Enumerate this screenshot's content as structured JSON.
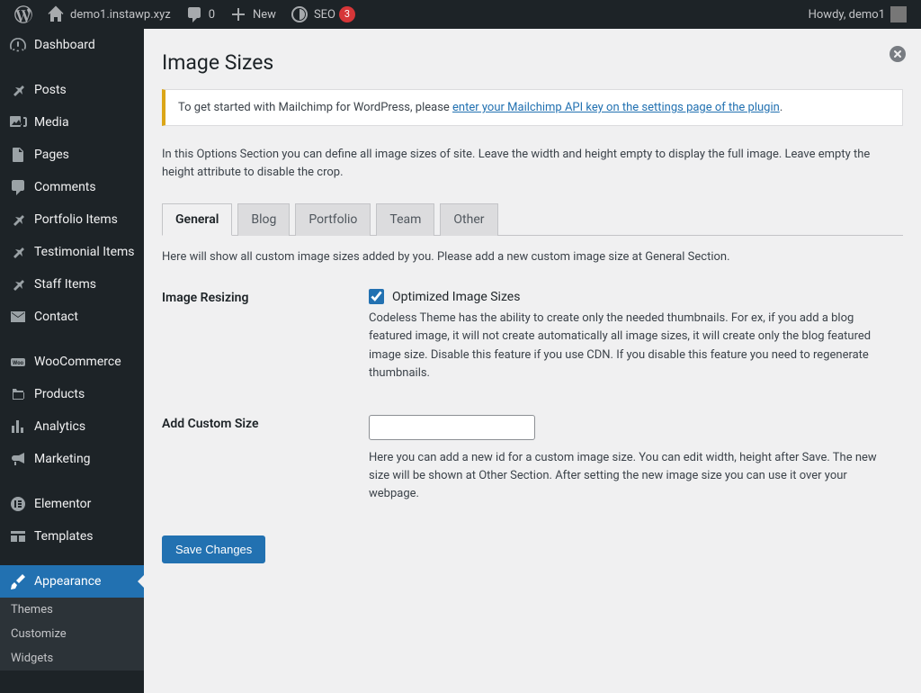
{
  "adminbar": {
    "site_name": "demo1.instawp.xyz",
    "comments_count": "0",
    "new_label": "New",
    "seo_label": "SEO",
    "seo_count": "3",
    "greeting": "Howdy, demo1"
  },
  "sidebar": {
    "items": [
      {
        "label": "Dashboard",
        "icon": "dashboard"
      },
      {
        "label": "Posts",
        "icon": "pin"
      },
      {
        "label": "Media",
        "icon": "media"
      },
      {
        "label": "Pages",
        "icon": "page"
      },
      {
        "label": "Comments",
        "icon": "comments"
      },
      {
        "label": "Portfolio Items",
        "icon": "pin"
      },
      {
        "label": "Testimonial Items",
        "icon": "pin"
      },
      {
        "label": "Staff Items",
        "icon": "pin"
      },
      {
        "label": "Contact",
        "icon": "mail"
      },
      {
        "label": "WooCommerce",
        "icon": "woo"
      },
      {
        "label": "Products",
        "icon": "product"
      },
      {
        "label": "Analytics",
        "icon": "chart"
      },
      {
        "label": "Marketing",
        "icon": "megaphone"
      },
      {
        "label": "Elementor",
        "icon": "elementor"
      },
      {
        "label": "Templates",
        "icon": "templates"
      },
      {
        "label": "Appearance",
        "icon": "brush"
      }
    ],
    "submenu": [
      "Themes",
      "Customize",
      "Widgets"
    ]
  },
  "page": {
    "title": "Image Sizes",
    "notice_prefix": "To get started with Mailchimp for WordPress, please ",
    "notice_link": "enter your Mailchimp API key on the settings page of the plugin",
    "notice_suffix": ".",
    "intro": "In this Options Section you can define all image sizes of site. Leave the width and height empty to display the full image. Leave empty the height attribute to disable the crop.",
    "tabs": [
      "General",
      "Blog",
      "Portfolio",
      "Team",
      "Other"
    ],
    "active_tab": "General",
    "tab_note": "Here will show all custom image sizes added by you. Please add a new custom image size at General Section.",
    "fields": {
      "resize_label": "Image Resizing",
      "resize_checkbox_label": "Optimized Image Sizes",
      "resize_checked": true,
      "resize_desc": "Codeless Theme has the ability to create only the needed thumbnails. For ex, if you add a blog featured image, it will not create automatically all image sizes, it will create only the blog featured image size. Disable this feature if you use CDN. If you disable this feature you need to regenerate thumbnails.",
      "custom_label": "Add Custom Size",
      "custom_value": "",
      "custom_desc": "Here you can add a new id for a custom image size. You can edit width, height after Save. The new size will be shown at Other Section. After setting the new image size you can use it over your webpage."
    },
    "save_button": "Save Changes"
  }
}
